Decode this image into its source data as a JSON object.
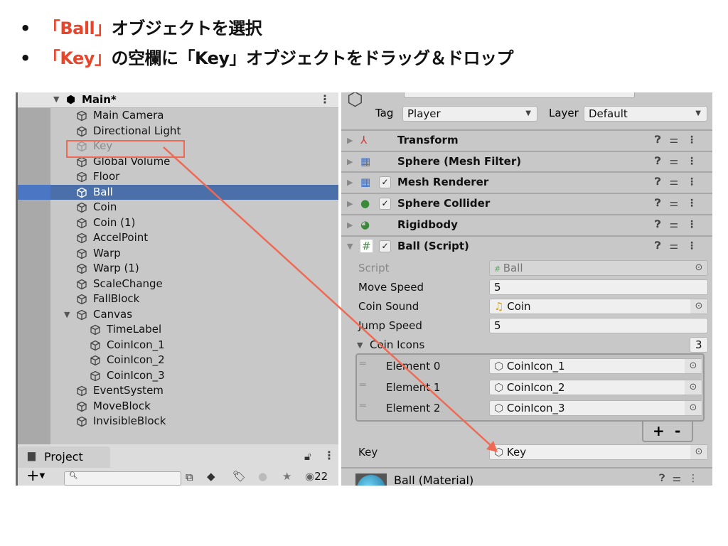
{
  "slide": {
    "bullets": [
      {
        "highlight": "「Ball」",
        "text": "オブジェクトを選択"
      },
      {
        "highlight": "「Key」",
        "text": "の空欄に「Key」オブジェクトをドラッグ＆ドロップ"
      }
    ],
    "accent_color": "#e8462c"
  },
  "hierarchy": {
    "scene": "Main*",
    "items": [
      {
        "label": "Main Camera",
        "depth": 0
      },
      {
        "label": "Directional Light",
        "depth": 0
      },
      {
        "label": "Key",
        "depth": 0,
        "inactive": true,
        "highlighted": true
      },
      {
        "label": "Global Volume",
        "depth": 0
      },
      {
        "label": "Floor",
        "depth": 0
      },
      {
        "label": "Ball",
        "depth": 0,
        "selected": true
      },
      {
        "label": "Coin",
        "depth": 0
      },
      {
        "label": "Coin (1)",
        "depth": 0
      },
      {
        "label": "AccelPoint",
        "depth": 0
      },
      {
        "label": "Warp",
        "depth": 0
      },
      {
        "label": "Warp (1)",
        "depth": 0
      },
      {
        "label": "ScaleChange",
        "depth": 0
      },
      {
        "label": "FallBlock",
        "depth": 0
      },
      {
        "label": "Canvas",
        "depth": 0,
        "expanded": true
      },
      {
        "label": "TimeLabel",
        "depth": 1
      },
      {
        "label": "CoinIcon_1",
        "depth": 1
      },
      {
        "label": "CoinIcon_2",
        "depth": 1
      },
      {
        "label": "CoinIcon_3",
        "depth": 1
      },
      {
        "label": "EventSystem",
        "depth": 0
      },
      {
        "label": "MoveBlock",
        "depth": 0
      },
      {
        "label": "InvisibleBlock",
        "depth": 0
      }
    ],
    "selected_color": "#4a6fa9"
  },
  "project": {
    "tab": "Project",
    "hidden_count": "22"
  },
  "inspector": {
    "tag_label": "Tag",
    "tag_value": "Player",
    "layer_label": "Layer",
    "layer_value": "Default",
    "components": [
      {
        "name": "Transform",
        "icon": "transform-icon",
        "checkbox": false
      },
      {
        "name": "Sphere (Mesh Filter)",
        "icon": "mesh-filter-icon",
        "checkbox": false
      },
      {
        "name": "Mesh Renderer",
        "icon": "mesh-renderer-icon",
        "checkbox": true
      },
      {
        "name": "Sphere Collider",
        "icon": "sphere-collider-icon",
        "checkbox": true
      },
      {
        "name": "Rigidbody",
        "icon": "rigidbody-icon",
        "checkbox": false
      },
      {
        "name": "Ball (Script)",
        "icon": "script-icon",
        "checkbox": true,
        "expanded": true
      }
    ],
    "fields": {
      "script": {
        "label": "Script",
        "value": "Ball"
      },
      "move_speed": {
        "label": "Move Speed",
        "value": "5"
      },
      "coin_sound": {
        "label": "Coin Sound",
        "value": "Coin"
      },
      "jump_speed": {
        "label": "Jump Speed",
        "value": "5"
      },
      "coin_icons": {
        "label": "Coin Icons",
        "size": "3",
        "elements": [
          {
            "label": "Element 0",
            "value": "CoinIcon_1"
          },
          {
            "label": "Element 1",
            "value": "CoinIcon_2"
          },
          {
            "label": "Element 2",
            "value": "CoinIcon_3"
          }
        ]
      },
      "key": {
        "label": "Key",
        "value": "Key"
      }
    },
    "add_label": "+",
    "remove_label": "-",
    "material": "Ball (Material)"
  }
}
